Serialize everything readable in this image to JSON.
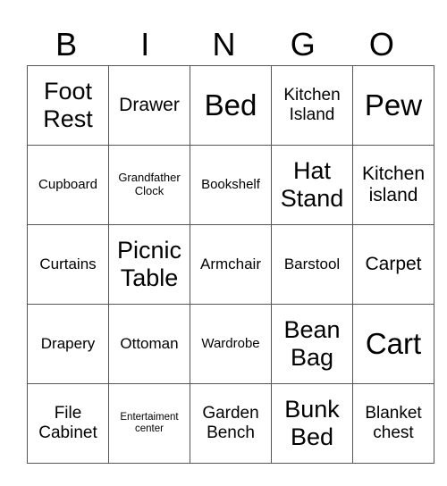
{
  "header": [
    "B",
    "I",
    "N",
    "G",
    "O"
  ],
  "rows": [
    [
      {
        "text": "Foot Rest",
        "size": "s-lg"
      },
      {
        "text": "Drawer",
        "size": "s-md"
      },
      {
        "text": "Bed",
        "size": "s-xl"
      },
      {
        "text": "Kitchen Island",
        "size": "s-m2"
      },
      {
        "text": "Pew",
        "size": "s-xl"
      }
    ],
    [
      {
        "text": "Cupboard",
        "size": "s-xs"
      },
      {
        "text": "Grandfather Clock",
        "size": "s-xxs"
      },
      {
        "text": "Bookshelf",
        "size": "s-xs"
      },
      {
        "text": "Hat Stand",
        "size": "s-lg"
      },
      {
        "text": "Kitchen island",
        "size": "s-md"
      }
    ],
    [
      {
        "text": "Curtains",
        "size": "s-sm"
      },
      {
        "text": "Picnic Table",
        "size": "s-lg"
      },
      {
        "text": "Armchair",
        "size": "s-sm"
      },
      {
        "text": "Barstool",
        "size": "s-sm"
      },
      {
        "text": "Carpet",
        "size": "s-md"
      }
    ],
    [
      {
        "text": "Drapery",
        "size": "s-sm"
      },
      {
        "text": "Ottoman",
        "size": "s-sm"
      },
      {
        "text": "Wardrobe",
        "size": "s-xs"
      },
      {
        "text": "Bean Bag",
        "size": "s-lg"
      },
      {
        "text": "Cart",
        "size": "s-xl"
      }
    ],
    [
      {
        "text": "File Cabinet",
        "size": "s-m2"
      },
      {
        "text": "Entertaiment center",
        "size": "s-tiny"
      },
      {
        "text": "Garden Bench",
        "size": "s-m2"
      },
      {
        "text": "Bunk Bed",
        "size": "s-lg"
      },
      {
        "text": "Blanket chest",
        "size": "s-m2"
      }
    ]
  ]
}
